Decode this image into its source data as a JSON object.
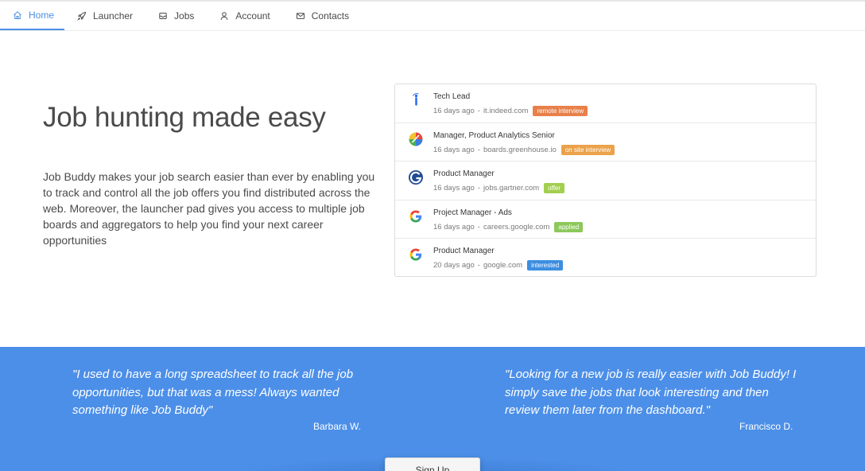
{
  "nav": {
    "items": [
      {
        "label": "Home",
        "icon": "home-icon"
      },
      {
        "label": "Launcher",
        "icon": "rocket-icon"
      },
      {
        "label": "Jobs",
        "icon": "inbox-icon"
      },
      {
        "label": "Account",
        "icon": "user-icon"
      },
      {
        "label": "Contacts",
        "icon": "mail-icon"
      }
    ],
    "active": "Home",
    "accent": "#4a90e2"
  },
  "hero": {
    "title": "Job hunting made easy",
    "description": "Job Buddy makes your job search easier than ever by enabling you to track and control all the job offers you find distributed across the web. Moreover, the launcher pad gives you access to multiple job boards and aggregators to help you find your next career opportunities"
  },
  "jobs": [
    {
      "title": "Tech Lead",
      "age": "16 days ago",
      "source": "it.indeed.com",
      "status": "remote interview",
      "status_color": "#e8804a",
      "logo": "indeed-logo-icon"
    },
    {
      "title": "Manager, Product Analytics Senior",
      "age": "16 days ago",
      "source": "boards.greenhouse.io",
      "status": "on site interview",
      "status_color": "#eba24a",
      "logo": "greenhouse-logo-icon"
    },
    {
      "title": "Product Manager",
      "age": "16 days ago",
      "source": "jobs.gartner.com",
      "status": "offer",
      "status_color": "#a3cf4f",
      "logo": "gartner-logo-icon"
    },
    {
      "title": "Project Manager - Ads",
      "age": "16 days ago",
      "source": "careers.google.com",
      "status": "applied",
      "status_color": "#8cc85a",
      "logo": "google-logo-icon"
    },
    {
      "title": "Product Manager",
      "age": "20 days ago",
      "source": "google.com",
      "status": "interested",
      "status_color": "#3d8ee0",
      "logo": "google-logo-icon"
    }
  ],
  "separator": "-",
  "testimonials": [
    {
      "quote": "\"I used to have a long spreadsheet to track all the job opportunities, but that was a mess! Always wanted something like Job Buddy\"",
      "author": "Barbara W."
    },
    {
      "quote": "\"Looking for a new job is really easier with Job Buddy! I simply save the jobs that look interesting and then review them later from the dashboard.\"",
      "author": "Francisco D."
    }
  ],
  "testimonials_bg": "#4c8fe8",
  "cta": {
    "label": "Sign Up"
  }
}
